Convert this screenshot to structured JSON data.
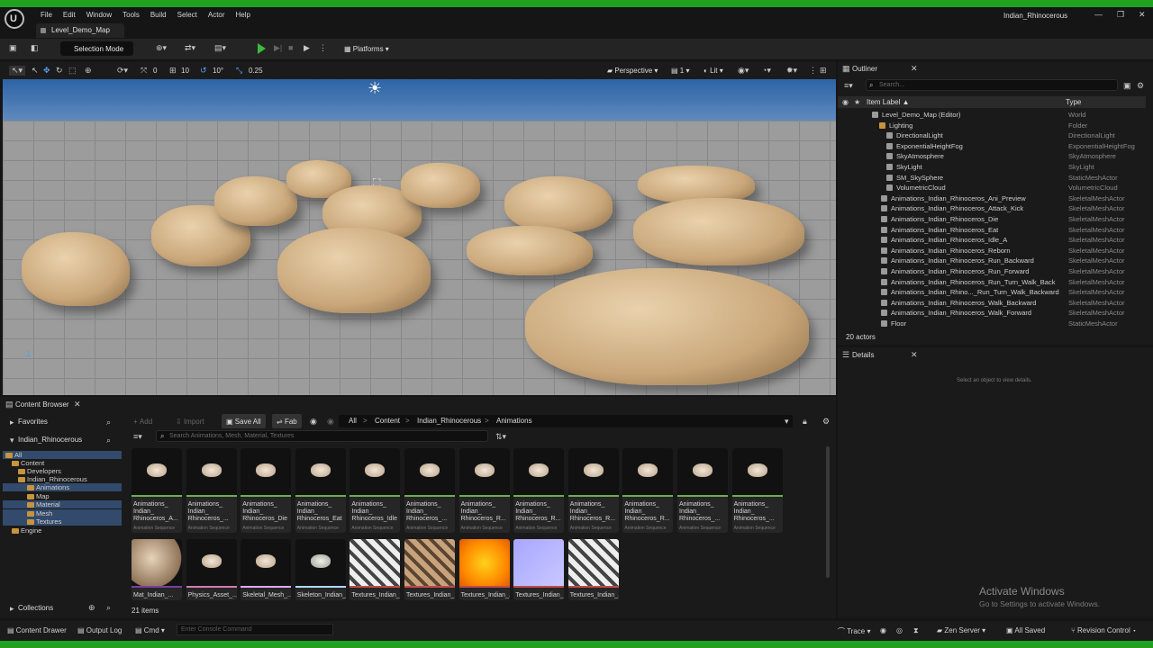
{
  "app": {
    "window_title": "Indian_Rhinocerous",
    "map_tab": "Level_Demo_Map"
  },
  "menu": [
    "File",
    "Edit",
    "Window",
    "Tools",
    "Build",
    "Select",
    "Actor",
    "Help"
  ],
  "toolbar": {
    "selection_mode": "Selection Mode",
    "platforms": "Platforms"
  },
  "viewport_toolbar": {
    "snap_translate": "0",
    "snap_grid": "10",
    "snap_rotate": "10°",
    "snap_scale": "0.25",
    "view_mode": "Perspective",
    "lit": "Lit",
    "camera_speed": "1"
  },
  "outliner": {
    "title": "Outliner",
    "search_placeholder": "Search...",
    "col_label": "Item Label ▲",
    "col_type": "Type",
    "footer": "20 actors",
    "rows": [
      {
        "label": "Level_Demo_Map (Editor)",
        "type": "World"
      },
      {
        "label": "Lighting",
        "type": "Folder"
      },
      {
        "label": "DirectionalLight",
        "type": "DirectionalLight"
      },
      {
        "label": "ExponentialHeightFog",
        "type": "ExponentialHeightFog"
      },
      {
        "label": "SkyAtmosphere",
        "type": "SkyAtmosphere"
      },
      {
        "label": "SkyLight",
        "type": "SkyLight"
      },
      {
        "label": "SM_SkySphere",
        "type": "StaticMeshActor"
      },
      {
        "label": "VolumetricCloud",
        "type": "VolumetricCloud"
      },
      {
        "label": "Animations_Indian_Rhinoceros_Ani_Preview",
        "type": "SkeletalMeshActor"
      },
      {
        "label": "Animations_Indian_Rhinoceros_Attack_Kick",
        "type": "SkeletalMeshActor"
      },
      {
        "label": "Animations_Indian_Rhinoceros_Die",
        "type": "SkeletalMeshActor"
      },
      {
        "label": "Animations_Indian_Rhinoceros_Eat",
        "type": "SkeletalMeshActor"
      },
      {
        "label": "Animations_Indian_Rhinoceros_Idle_A",
        "type": "SkeletalMeshActor"
      },
      {
        "label": "Animations_Indian_Rhinoceros_Reborn",
        "type": "SkeletalMeshActor"
      },
      {
        "label": "Animations_Indian_Rhinoceros_Run_Backward",
        "type": "SkeletalMeshActor"
      },
      {
        "label": "Animations_Indian_Rhinoceros_Run_Forward",
        "type": "SkeletalMeshActor"
      },
      {
        "label": "Animations_Indian_Rhinoceros_Run_Turn_Walk_Back",
        "type": "SkeletalMeshActor"
      },
      {
        "label": "Animations_Indian_Rhino..._Run_Turn_Walk_Backward",
        "type": "SkeletalMeshActor"
      },
      {
        "label": "Animations_Indian_Rhinoceros_Walk_Backward",
        "type": "SkeletalMeshActor"
      },
      {
        "label": "Animations_Indian_Rhinoceros_Walk_Forward",
        "type": "SkeletalMeshActor"
      },
      {
        "label": "Floor",
        "type": "StaticMeshActor"
      }
    ]
  },
  "details": {
    "title": "Details",
    "empty": "Select an object to view details."
  },
  "content_browser": {
    "title": "Content Browser",
    "favorites": "Favorites",
    "root": "Indian_Rhinocerous",
    "collections": "Collections",
    "add": "Add",
    "import": "Import",
    "save_all": "Save All",
    "fab": "Fab",
    "path": [
      "All",
      "Content",
      "Indian_Rhinocerous",
      "Animations"
    ],
    "search_placeholder": "Search Animations, Mesh, Material, Textures",
    "item_count": "21 items",
    "tree": [
      "All",
      "Content",
      "Developers",
      "Indian_Rhinocerous",
      "Animations",
      "Map",
      "Material",
      "Mesh",
      "Textures",
      "Engine"
    ],
    "assets": [
      {
        "name": "Animations_\nIndian_\nRhinoceros_A...",
        "type": "Animation Sequence"
      },
      {
        "name": "Animations_\nIndian_\nRhinoceros_...",
        "type": "Animation Sequence"
      },
      {
        "name": "Animations_\nIndian_\nRhinoceros_Die",
        "type": "Animation Sequence"
      },
      {
        "name": "Animations_\nIndian_\nRhinoceros_Eat",
        "type": "Animation Sequence"
      },
      {
        "name": "Animations_\nIndian_\nRhinoceros_Idle",
        "type": "Animation Sequence"
      },
      {
        "name": "Animations_\nIndian_\nRhinoceros_...",
        "type": "Animation Sequence"
      },
      {
        "name": "Animations_\nIndian_\nRhinoceros_R...",
        "type": "Animation Sequence"
      },
      {
        "name": "Animations_\nIndian_\nRhinoceros_R...",
        "type": "Animation Sequence"
      },
      {
        "name": "Animations_\nIndian_\nRhinoceros_R...",
        "type": "Animation Sequence"
      },
      {
        "name": "Animations_\nIndian_\nRhinoceros_R...",
        "type": "Animation Sequence"
      },
      {
        "name": "Animations_\nIndian_\nRhinoceros_...",
        "type": "Animation Sequence"
      },
      {
        "name": "Animations_\nIndian_\nRhinoceros_...",
        "type": "Animation Sequence"
      },
      {
        "name": "Mat_Indian_...",
        "type": ""
      },
      {
        "name": "Physics_Asset_...",
        "type": ""
      },
      {
        "name": "Skeletal_Mesh_...",
        "type": ""
      },
      {
        "name": "Skeleton_Indian_...",
        "type": ""
      },
      {
        "name": "Textures_Indian_...",
        "type": ""
      },
      {
        "name": "Textures_Indian_...",
        "type": ""
      },
      {
        "name": "Textures_Indian_...",
        "type": ""
      },
      {
        "name": "Textures_Indian_...",
        "type": ""
      },
      {
        "name": "Textures_Indian_...",
        "type": ""
      }
    ]
  },
  "statusbar": {
    "content_drawer": "Content Drawer",
    "output_log": "Output Log",
    "cmd": "Cmd",
    "console_placeholder": "Enter Console Command",
    "trace": "Trace",
    "zen": "Zen Server",
    "saved": "All Saved",
    "revision": "Revision Control"
  },
  "activation": {
    "title": "Activate Windows",
    "subtitle": "Go to Settings to activate Windows."
  }
}
